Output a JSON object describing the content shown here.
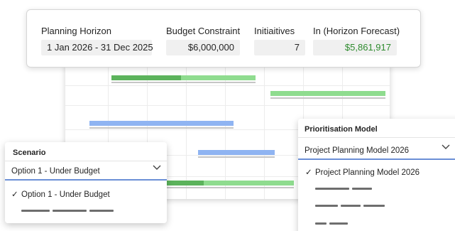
{
  "summary": {
    "planning_horizon": {
      "label": "Planning Horizon",
      "value": "1 Jan 2026 - 31 Dec 2025"
    },
    "budget_constraint": {
      "label": "Budget Constraint",
      "value": "$6,000,000"
    },
    "initiatives": {
      "label": "Initiaitives",
      "value": "7"
    },
    "forecast": {
      "label": "In (Horizon Forecast)",
      "value": "$5,861,917",
      "value_color": "#2e8b2e"
    }
  },
  "scenario": {
    "title": "Scenario",
    "selected": "Option 1 - Under Budget",
    "options": [
      {
        "label": "Option 1 - Under Budget",
        "checked": true
      }
    ]
  },
  "prioritisation": {
    "title": "Prioritisation Model",
    "selected": "Project Planning Model 2026",
    "options": [
      {
        "label": "Project Planning Model 2026",
        "checked": true
      }
    ]
  },
  "icons": {
    "check": "✓",
    "chevron": "chevron-down-icon"
  },
  "colors": {
    "bar_green": "#8fdc8f",
    "bar_green_dark": "#5cb35c",
    "bar_blue": "#8fb4f2",
    "accent": "#6b8fd6"
  }
}
